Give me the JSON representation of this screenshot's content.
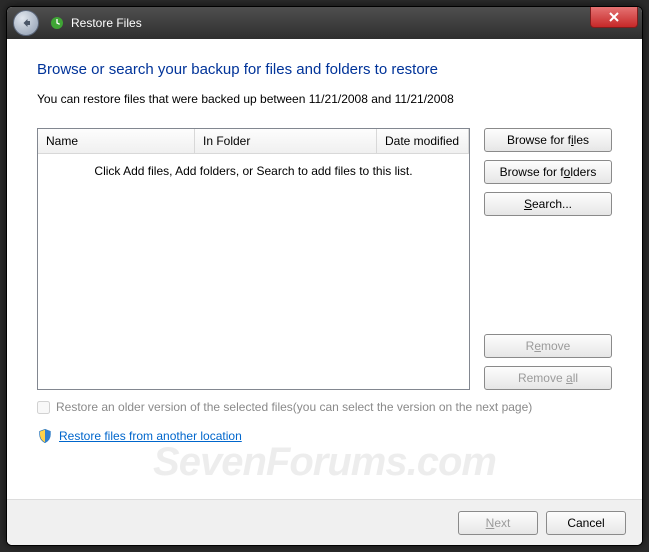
{
  "window": {
    "title": "Restore Files"
  },
  "heading": "Browse or search your backup for files and folders to restore",
  "subhead": "You can restore files that were backed up between 11/21/2008 and 11/21/2008",
  "list": {
    "columns": {
      "name": "Name",
      "folder": "In Folder",
      "date": "Date modified"
    },
    "empty_msg": "Click Add files, Add folders, or Search to add files to this list."
  },
  "buttons": {
    "browse_files": "Browse for files",
    "browse_folders": "Browse for folders",
    "search": "Search...",
    "remove": "Remove",
    "remove_all": "Remove all",
    "next": "Next",
    "cancel": "Cancel"
  },
  "checkbox_label": "Restore an older version of the selected files(you can select the version on the next page)",
  "link_label": "Restore files from another location",
  "watermark": "SevenForums.com"
}
